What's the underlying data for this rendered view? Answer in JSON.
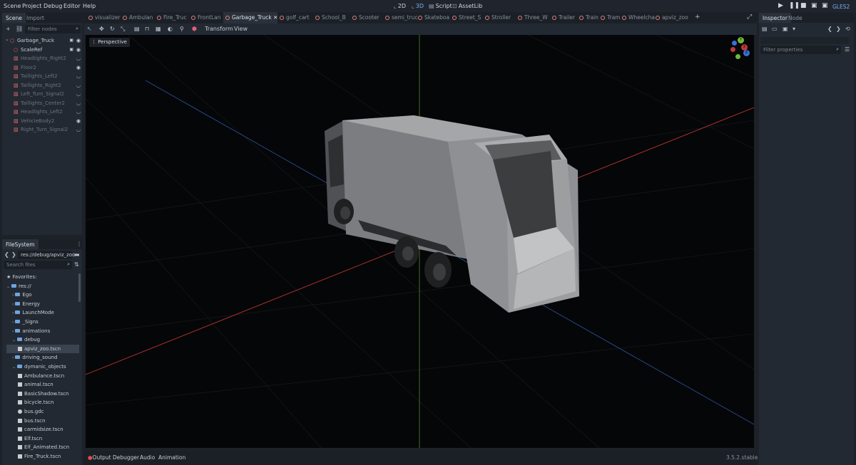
{
  "menu": [
    "Scene",
    "Project",
    "Debug",
    "Editor",
    "Help"
  ],
  "modes": {
    "m2d": "2D",
    "m3d": "3D",
    "script": "Script",
    "assetlib": "AssetLib"
  },
  "renderer": "GLES2",
  "scene_dock": {
    "tabs": [
      "Scene",
      "Import"
    ],
    "filter_placeholder": "Filter nodes",
    "nodes": [
      {
        "label": "Garbage_Truck",
        "visible_icon": true
      },
      {
        "label": "ScaleRef",
        "visible_icon": true
      },
      {
        "label": "Headlights_Right2"
      },
      {
        "label": "Floor2",
        "visible_icon": true
      },
      {
        "label": "Taillights_Left2"
      },
      {
        "label": "Taillights_Right2"
      },
      {
        "label": "Left_Turn_Signal2"
      },
      {
        "label": "Taillights_Center2"
      },
      {
        "label": "Headlights_Left2"
      },
      {
        "label": "VehicleBody2",
        "visible_icon": true
      },
      {
        "label": "Right_Turn_Signal2"
      }
    ]
  },
  "filesystem": {
    "title": "FileSystem",
    "path": "res://debug/apviz_zoo",
    "search_placeholder": "Search files",
    "items": [
      {
        "label": "Favorites:",
        "kind": "fav",
        "indent": 0
      },
      {
        "label": "res://",
        "kind": "folder",
        "indent": 0
      },
      {
        "label": "Ego",
        "kind": "folder",
        "indent": 1
      },
      {
        "label": "Energy",
        "kind": "folder",
        "indent": 1
      },
      {
        "label": "LaunchMode",
        "kind": "folder",
        "indent": 1
      },
      {
        "label": "_Signs",
        "kind": "folder",
        "indent": 1
      },
      {
        "label": "animations",
        "kind": "folder",
        "indent": 1
      },
      {
        "label": "debug",
        "kind": "folder",
        "indent": 1
      },
      {
        "label": "apviz_zoo.tscn",
        "kind": "file",
        "indent": 2,
        "selected": true
      },
      {
        "label": "driving_sound",
        "kind": "folder",
        "indent": 1
      },
      {
        "label": "dymanic_objects",
        "kind": "folder",
        "indent": 1
      },
      {
        "label": "Ambulance.tscn",
        "kind": "file",
        "indent": 2
      },
      {
        "label": "animal.tscn",
        "kind": "file",
        "indent": 2
      },
      {
        "label": "BasicShadow.tscn",
        "kind": "file",
        "indent": 2
      },
      {
        "label": "bicycle.tscn",
        "kind": "file",
        "indent": 2
      },
      {
        "label": "bus.gdc",
        "kind": "file",
        "indent": 2
      },
      {
        "label": "bus.tscn",
        "kind": "file",
        "indent": 2
      },
      {
        "label": "carmidsize.tscn",
        "kind": "file",
        "indent": 2
      },
      {
        "label": "Elf.tscn",
        "kind": "file",
        "indent": 2
      },
      {
        "label": "Elf_Animated.tscn",
        "kind": "file",
        "indent": 2
      },
      {
        "label": "Fire_Truck.tscn",
        "kind": "file",
        "indent": 2
      }
    ]
  },
  "editor_tabs": [
    "visualizer",
    "Ambulan",
    "Fire_Truc",
    "FrontLan",
    "Garbage_Truck",
    "golf_cart",
    "School_B",
    "Scooter",
    "semi_truc",
    "Skateboa",
    "Street_S",
    "Stroller",
    "Three_W",
    "Trailer",
    "Train",
    "Tram",
    "Wheelcha",
    "apviz_zoo"
  ],
  "active_tab": "Garbage_Truck",
  "viewport": {
    "toolbar": {
      "transform": "Transform",
      "view": "View"
    },
    "perspective_label": "Perspective",
    "gizmo": {
      "x": "X",
      "y": "Y",
      "z": "Z"
    }
  },
  "inspector": {
    "tabs": [
      "Inspector",
      "Node"
    ],
    "filter_placeholder": "Filter properties"
  },
  "bottom_tabs": {
    "output": "Output",
    "debugger": "Debugger",
    "audio": "Audio",
    "animation": "Animation"
  },
  "version": "3.5.2.stable",
  "colors": {
    "accent": "#79aef5",
    "x_axis": "#d9443f",
    "y_axis": "#7fbf3f",
    "z_axis": "#3f6fd9"
  }
}
